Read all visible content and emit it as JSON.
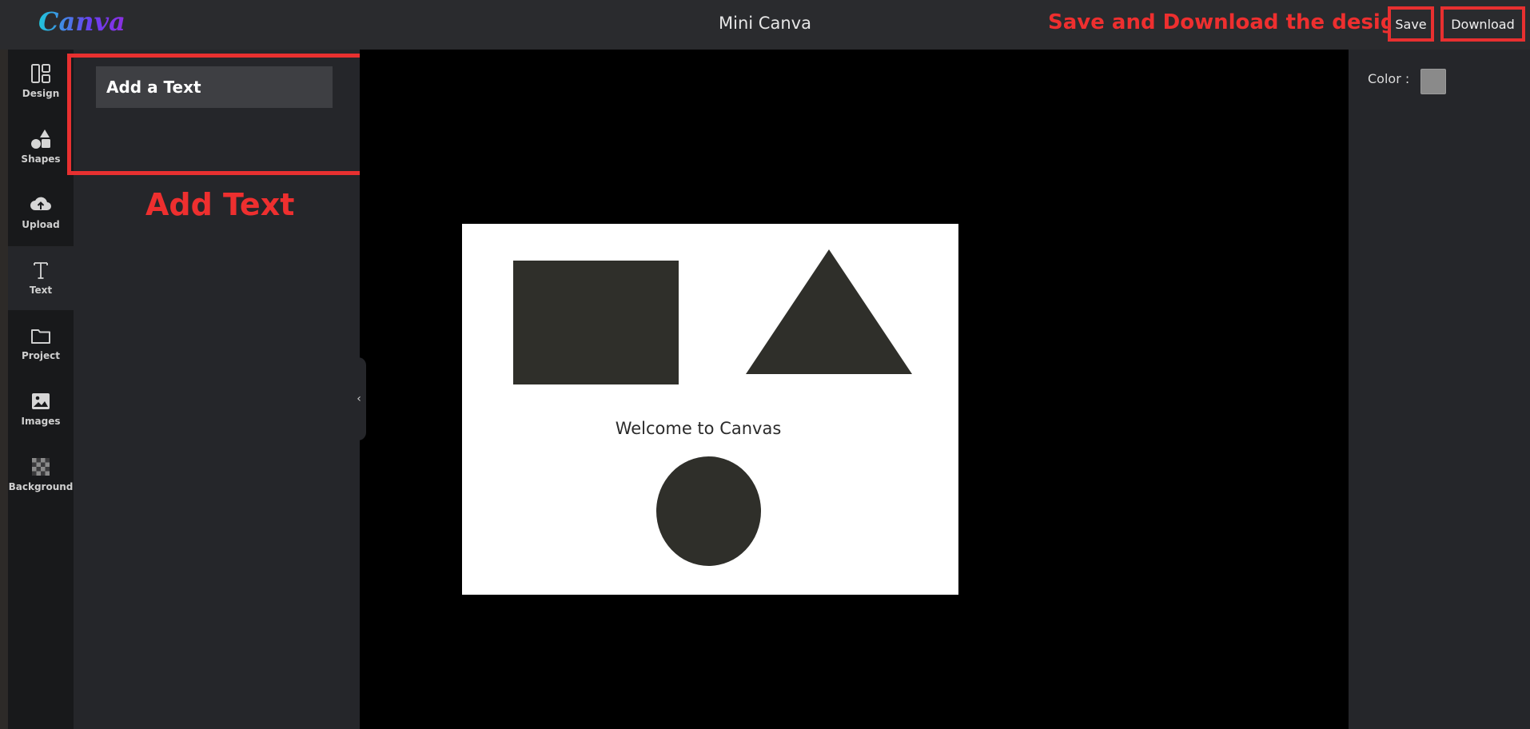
{
  "header": {
    "logo": "Canva",
    "title": "Mini Canva",
    "annotation": "Save and Download the design",
    "save_label": "Save",
    "download_label": "Download"
  },
  "sidebar": {
    "items": [
      {
        "label": "Design",
        "icon": "layout-icon"
      },
      {
        "label": "Shapes",
        "icon": "shapes-icon"
      },
      {
        "label": "Upload",
        "icon": "cloud-upload-icon"
      },
      {
        "label": "Text",
        "icon": "text-icon",
        "active": true
      },
      {
        "label": "Project",
        "icon": "folder-icon"
      },
      {
        "label": "Images",
        "icon": "image-icon"
      },
      {
        "label": "Background",
        "icon": "checkerboard-icon"
      }
    ]
  },
  "panel": {
    "add_text_label": "Add a Text",
    "annotation": "Add Text"
  },
  "canvas": {
    "text": "Welcome to Canvas",
    "shape_fill": "#2f2f2a"
  },
  "properties": {
    "color_label": "Color :",
    "color_value": "#8a8a8a"
  },
  "colors": {
    "annotation_red": "#e83030",
    "topbar": "#2a2b2e",
    "panel": "#25262a",
    "rail": "#18191b"
  }
}
